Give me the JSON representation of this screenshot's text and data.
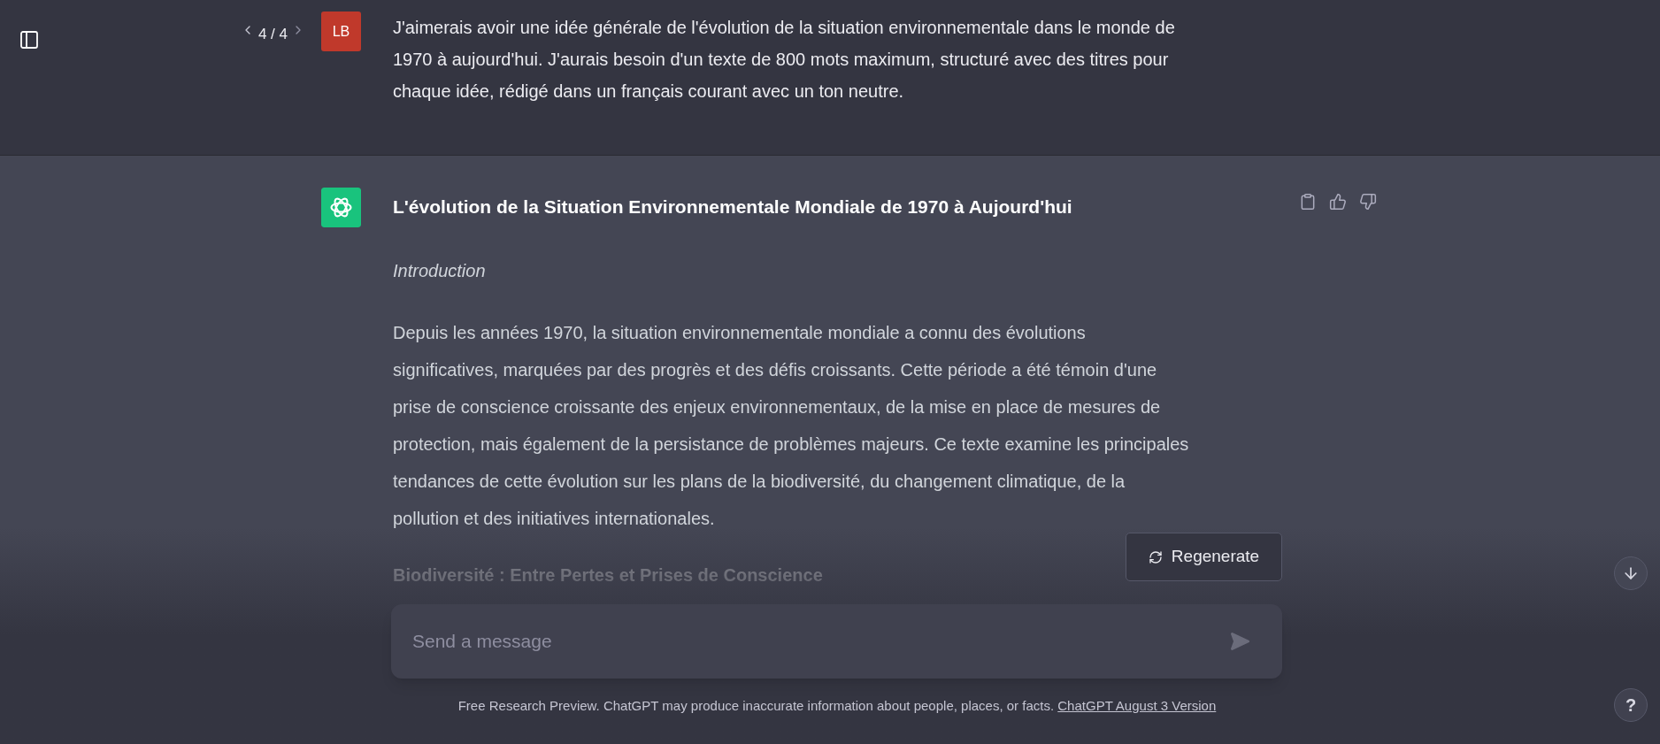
{
  "user_message": {
    "pager": "4 / 4",
    "avatar": "LB",
    "text": "J'aimerais avoir une idée générale de l'évolution de la situation environnementale dans le monde de 1970 à aujourd'hui. J'aurais besoin d'un texte de 800 mots maximum, structuré avec des titres pour chaque idée, rédigé dans un français courant avec un ton neutre."
  },
  "assistant_message": {
    "title": "L'évolution de la Situation Environnementale Mondiale de 1970 à Aujourd'hui",
    "blocks": [
      {
        "kind": "subtitle",
        "text": "Introduction"
      },
      {
        "kind": "paragraph",
        "text": "Depuis les années 1970, la situation environnementale mondiale a connu des évolutions significatives, marquées par des progrès et des défis croissants. Cette période a été témoin d'une prise de conscience croissante des enjeux environnementaux, de la mise en place de mesures de protection, mais également de la persistance de problèmes majeurs. Ce texte examine les principales tendances de cette évolution sur les plans de la biodiversité, du changement climatique, de la pollution et des initiatives internationales."
      },
      {
        "kind": "heading",
        "text": "Biodiversité : Entre Pertes et Prises de Conscience"
      }
    ]
  },
  "regenerate_button": "Regenerate",
  "composer": {
    "placeholder": "Send a message"
  },
  "footer": {
    "text": "Free Research Preview. ChatGPT may produce inaccurate information about people, places, or facts.",
    "link": "ChatGPT August 3 Version"
  },
  "help_button": "?"
}
